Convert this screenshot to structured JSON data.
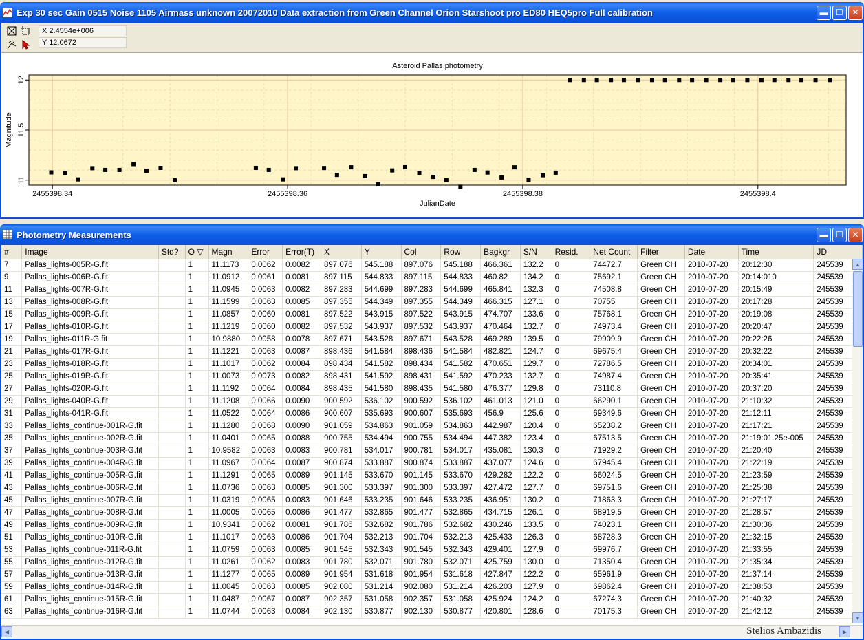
{
  "chart_window": {
    "title": "Exp 30 sec Gain 0515 Noise 1105 Airmass unknown 20072010 Data extraction from Green Channel Orion Starshoot pro ED80 HEQ5pro Full calibration",
    "coord_x": "X 2.4554e+006",
    "coord_y": "Y 12.0672"
  },
  "chart_data": {
    "type": "scatter",
    "title": "Asteroid Pallas photometry",
    "xlabel": "JulianDate",
    "ylabel": "Magnitude",
    "x_ticks": [
      "2455398.34",
      "2455398.36",
      "2455398.38",
      "2455398.4"
    ],
    "y_ticks": [
      "11",
      "11.5",
      "12"
    ],
    "xlim": [
      2455398.338,
      2455398.4075
    ],
    "ylim": [
      10.95,
      12.05
    ],
    "grid": true,
    "series": [
      {
        "x": [
          2455398.3399,
          2455398.3411,
          2455398.3422,
          2455398.3434,
          2455398.3445,
          2455398.3457,
          2455398.3469,
          2455398.348,
          2455398.3492,
          2455398.3504,
          2455398.3573,
          2455398.3584,
          2455398.3596,
          2455398.3607,
          2455398.3631,
          2455398.3642,
          2455398.3654,
          2455398.3666,
          2455398.3677,
          2455398.3689,
          2455398.37,
          2455398.3712,
          2455398.3724,
          2455398.3735,
          2455398.3747,
          2455398.3759,
          2455398.377,
          2455398.3782,
          2455398.3793,
          2455398.3805,
          2455398.3817,
          2455398.3828,
          2455398.384,
          2455398.3852,
          2455398.3863,
          2455398.3875,
          2455398.3886,
          2455398.3898,
          2455398.391,
          2455398.3921,
          2455398.3933,
          2455398.3944,
          2455398.3956,
          2455398.3968,
          2455398.3979,
          2455398.3991,
          2455398.4003,
          2455398.4014,
          2455398.4026,
          2455398.4037,
          2455398.4049,
          2455398.4061
        ],
        "y": [
          11.0773,
          11.07,
          11.0073,
          11.1192,
          11.1017,
          11.1017,
          11.1599,
          11.0945,
          11.1219,
          10.998,
          11.1221,
          11.1017,
          11.0073,
          11.1192,
          11.1208,
          11.0522,
          11.128,
          11.0401,
          10.9582,
          11.0967,
          11.1291,
          11.0736,
          11.0319,
          11.0005,
          10.9341,
          11.1017,
          11.0759,
          11.0261,
          11.1277,
          11.0045,
          11.0487,
          11.0744,
          12.0,
          12.0,
          12.0,
          12.0,
          12.0,
          12.0,
          12.0,
          12.0,
          12.0,
          12.0,
          12.0,
          12.0,
          12.0,
          12.0,
          12.0,
          12.0,
          12.0,
          12.0,
          12.0,
          12.0
        ]
      }
    ]
  },
  "table_window": {
    "title": "Photometry Measurements",
    "columns": [
      "#",
      "Image",
      "Std?",
      "O ▽",
      "Magn",
      "Error",
      "Error(T)",
      "X",
      "Y",
      "Col",
      "Row",
      "Bagkgr",
      "S/N",
      "Resid.",
      "Net Count",
      "Filter",
      "Date",
      "Time",
      "JD"
    ],
    "rows": [
      [
        "7",
        "Pallas_lights-005R-G.fit",
        "",
        "1",
        "11.1173",
        "0.0062",
        "0.0082",
        "897.076",
        "545.188",
        "897.076",
        "545.188",
        "466.361",
        "132.2",
        "0",
        "74472.7",
        "Green CH",
        "2010-07-20",
        "20:12:30",
        "245539"
      ],
      [
        "9",
        "Pallas_lights-006R-G.fit",
        "",
        "1",
        "11.0912",
        "0.0061",
        "0.0081",
        "897.115",
        "544.833",
        "897.115",
        "544.833",
        "460.82",
        "134.2",
        "0",
        "75692.1",
        "Green CH",
        "2010-07-20",
        "20:14:010",
        "245539"
      ],
      [
        "11",
        "Pallas_lights-007R-G.fit",
        "",
        "1",
        "11.0945",
        "0.0063",
        "0.0082",
        "897.283",
        "544.699",
        "897.283",
        "544.699",
        "465.841",
        "132.3",
        "0",
        "74508.8",
        "Green CH",
        "2010-07-20",
        "20:15:49",
        "245539"
      ],
      [
        "13",
        "Pallas_lights-008R-G.fit",
        "",
        "1",
        "11.1599",
        "0.0063",
        "0.0085",
        "897.355",
        "544.349",
        "897.355",
        "544.349",
        "466.315",
        "127.1",
        "0",
        "70755",
        "Green CH",
        "2010-07-20",
        "20:17:28",
        "245539"
      ],
      [
        "15",
        "Pallas_lights-009R-G.fit",
        "",
        "1",
        "11.0857",
        "0.0060",
        "0.0081",
        "897.522",
        "543.915",
        "897.522",
        "543.915",
        "474.707",
        "133.6",
        "0",
        "75768.1",
        "Green CH",
        "2010-07-20",
        "20:19:08",
        "245539"
      ],
      [
        "17",
        "Pallas_lights-010R-G.fit",
        "",
        "1",
        "11.1219",
        "0.0060",
        "0.0082",
        "897.532",
        "543.937",
        "897.532",
        "543.937",
        "470.464",
        "132.7",
        "0",
        "74973.4",
        "Green CH",
        "2010-07-20",
        "20:20:47",
        "245539"
      ],
      [
        "19",
        "Pallas_lights-011R-G.fit",
        "",
        "1",
        "10.9880",
        "0.0058",
        "0.0078",
        "897.671",
        "543.528",
        "897.671",
        "543.528",
        "469.289",
        "139.5",
        "0",
        "79909.9",
        "Green CH",
        "2010-07-20",
        "20:22:26",
        "245539"
      ],
      [
        "21",
        "Pallas_lights-017R-G.fit",
        "",
        "1",
        "11.1221",
        "0.0063",
        "0.0087",
        "898.436",
        "541.584",
        "898.436",
        "541.584",
        "482.821",
        "124.7",
        "0",
        "69675.4",
        "Green CH",
        "2010-07-20",
        "20:32:22",
        "245539"
      ],
      [
        "23",
        "Pallas_lights-018R-G.fit",
        "",
        "1",
        "11.1017",
        "0.0062",
        "0.0084",
        "898.434",
        "541.582",
        "898.434",
        "541.582",
        "470.651",
        "129.7",
        "0",
        "72786.5",
        "Green CH",
        "2010-07-20",
        "20:34:01",
        "245539"
      ],
      [
        "25",
        "Pallas_lights-019R-G.fit",
        "",
        "1",
        "11.0073",
        "0.0073",
        "0.0082",
        "898.431",
        "541.592",
        "898.431",
        "541.592",
        "470.233",
        "132.7",
        "0",
        "74987.4",
        "Green CH",
        "2010-07-20",
        "20:35:41",
        "245539"
      ],
      [
        "27",
        "Pallas_lights-020R-G.fit",
        "",
        "1",
        "11.1192",
        "0.0064",
        "0.0084",
        "898.435",
        "541.580",
        "898.435",
        "541.580",
        "476.377",
        "129.8",
        "0",
        "73110.8",
        "Green CH",
        "2010-07-20",
        "20:37:20",
        "245539"
      ],
      [
        "29",
        "Pallas_lights-040R-G.fit",
        "",
        "1",
        "11.1208",
        "0.0066",
        "0.0090",
        "900.592",
        "536.102",
        "900.592",
        "536.102",
        "461.013",
        "121.0",
        "0",
        "66290.1",
        "Green CH",
        "2010-07-20",
        "21:10:32",
        "245539"
      ],
      [
        "31",
        "Pallas_lights-041R-G.fit",
        "",
        "1",
        "11.0522",
        "0.0064",
        "0.0086",
        "900.607",
        "535.693",
        "900.607",
        "535.693",
        "456.9",
        "125.6",
        "0",
        "69349.6",
        "Green CH",
        "2010-07-20",
        "21:12:11",
        "245539"
      ],
      [
        "33",
        "Pallas_lights_continue-001R-G.fit",
        "",
        "1",
        "11.1280",
        "0.0068",
        "0.0090",
        "901.059",
        "534.863",
        "901.059",
        "534.863",
        "442.987",
        "120.4",
        "0",
        "65238.2",
        "Green CH",
        "2010-07-20",
        "21:17:21",
        "245539"
      ],
      [
        "35",
        "Pallas_lights_continue-002R-G.fit",
        "",
        "1",
        "11.0401",
        "0.0065",
        "0.0088",
        "900.755",
        "534.494",
        "900.755",
        "534.494",
        "447.382",
        "123.4",
        "0",
        "67513.5",
        "Green CH",
        "2010-07-20",
        "21:19:01.25e-005",
        "245539"
      ],
      [
        "37",
        "Pallas_lights_continue-003R-G.fit",
        "",
        "1",
        "10.9582",
        "0.0063",
        "0.0083",
        "900.781",
        "534.017",
        "900.781",
        "534.017",
        "435.081",
        "130.3",
        "0",
        "71929.2",
        "Green CH",
        "2010-07-20",
        "21:20:40",
        "245539"
      ],
      [
        "39",
        "Pallas_lights_continue-004R-G.fit",
        "",
        "1",
        "11.0967",
        "0.0064",
        "0.0087",
        "900.874",
        "533.887",
        "900.874",
        "533.887",
        "437.077",
        "124.6",
        "0",
        "67945.4",
        "Green CH",
        "2010-07-20",
        "21:22:19",
        "245539"
      ],
      [
        "41",
        "Pallas_lights_continue-005R-G.fit",
        "",
        "1",
        "11.1291",
        "0.0065",
        "0.0089",
        "901.145",
        "533.670",
        "901.145",
        "533.670",
        "429.282",
        "122.2",
        "0",
        "66024.5",
        "Green CH",
        "2010-07-20",
        "21:23:59",
        "245539"
      ],
      [
        "43",
        "Pallas_lights_continue-006R-G.fit",
        "",
        "1",
        "11.0736",
        "0.0063",
        "0.0085",
        "901.300",
        "533.397",
        "901.300",
        "533.397",
        "427.472",
        "127.7",
        "0",
        "69751.6",
        "Green CH",
        "2010-07-20",
        "21:25:38",
        "245539"
      ],
      [
        "45",
        "Pallas_lights_continue-007R-G.fit",
        "",
        "1",
        "11.0319",
        "0.0065",
        "0.0083",
        "901.646",
        "533.235",
        "901.646",
        "533.235",
        "436.951",
        "130.2",
        "0",
        "71863.3",
        "Green CH",
        "2010-07-20",
        "21:27:17",
        "245539"
      ],
      [
        "47",
        "Pallas_lights_continue-008R-G.fit",
        "",
        "1",
        "11.0005",
        "0.0065",
        "0.0086",
        "901.477",
        "532.865",
        "901.477",
        "532.865",
        "434.715",
        "126.1",
        "0",
        "68919.5",
        "Green CH",
        "2010-07-20",
        "21:28:57",
        "245539"
      ],
      [
        "49",
        "Pallas_lights_continue-009R-G.fit",
        "",
        "1",
        "10.9341",
        "0.0062",
        "0.0081",
        "901.786",
        "532.682",
        "901.786",
        "532.682",
        "430.246",
        "133.5",
        "0",
        "74023.1",
        "Green CH",
        "2010-07-20",
        "21:30:36",
        "245539"
      ],
      [
        "51",
        "Pallas_lights_continue-010R-G.fit",
        "",
        "1",
        "11.1017",
        "0.0063",
        "0.0086",
        "901.704",
        "532.213",
        "901.704",
        "532.213",
        "425.433",
        "126.3",
        "0",
        "68728.3",
        "Green CH",
        "2010-07-20",
        "21:32:15",
        "245539"
      ],
      [
        "53",
        "Pallas_lights_continue-011R-G.fit",
        "",
        "1",
        "11.0759",
        "0.0063",
        "0.0085",
        "901.545",
        "532.343",
        "901.545",
        "532.343",
        "429.401",
        "127.9",
        "0",
        "69976.7",
        "Green CH",
        "2010-07-20",
        "21:33:55",
        "245539"
      ],
      [
        "55",
        "Pallas_lights_continue-012R-G.fit",
        "",
        "1",
        "11.0261",
        "0.0062",
        "0.0083",
        "901.780",
        "532.071",
        "901.780",
        "532.071",
        "425.759",
        "130.0",
        "0",
        "71350.4",
        "Green CH",
        "2010-07-20",
        "21:35:34",
        "245539"
      ],
      [
        "57",
        "Pallas_lights_continue-013R-G.fit",
        "",
        "1",
        "11.1277",
        "0.0065",
        "0.0089",
        "901.954",
        "531.618",
        "901.954",
        "531.618",
        "427.847",
        "122.2",
        "0",
        "65961.9",
        "Green CH",
        "2010-07-20",
        "21:37:14",
        "245539"
      ],
      [
        "59",
        "Pallas_lights_continue-014R-G.fit",
        "",
        "1",
        "11.0045",
        "0.0063",
        "0.0085",
        "902.080",
        "531.214",
        "902.080",
        "531.214",
        "426.203",
        "127.9",
        "0",
        "69862.4",
        "Green CH",
        "2010-07-20",
        "21:38:53",
        "245539"
      ],
      [
        "61",
        "Pallas_lights_continue-015R-G.fit",
        "",
        "1",
        "11.0487",
        "0.0067",
        "0.0087",
        "902.357",
        "531.058",
        "902.357",
        "531.058",
        "425.924",
        "124.2",
        "0",
        "67274.3",
        "Green CH",
        "2010-07-20",
        "21:40:32",
        "245539"
      ],
      [
        "63",
        "Pallas_lights_continue-016R-G.fit",
        "",
        "1",
        "11.0744",
        "0.0063",
        "0.0084",
        "902.130",
        "530.877",
        "902.130",
        "530.877",
        "420.801",
        "128.6",
        "0",
        "70175.3",
        "Green CH",
        "2010-07-20",
        "21:42:12",
        "245539"
      ]
    ]
  },
  "signature": "Stelios Ambazidis",
  "colors": {
    "plot_bg": "#fff5c8",
    "grid_major": "#f0c8a0",
    "grid_minor": "#e8e0b0",
    "marker": "#000000",
    "titlebar": "#0a4fd6"
  }
}
